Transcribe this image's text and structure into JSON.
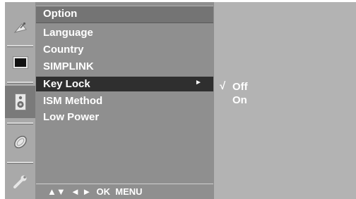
{
  "menu": {
    "title": "Option",
    "items": [
      {
        "label": "Language"
      },
      {
        "label": "Country"
      },
      {
        "label": "SIMPLINK"
      },
      {
        "label": "Key Lock",
        "selected": true
      },
      {
        "label": "ISM Method"
      },
      {
        "label": "Low Power"
      }
    ],
    "submenu_arrow": "►",
    "hint_bar": "▲▼  ◄ ►  OK  MENU"
  },
  "submenu": {
    "check_mark": "√",
    "options": [
      "Off",
      "On"
    ],
    "selected": "Off"
  },
  "sidebar_icons": [
    "satellite-dish-icon",
    "screen-icon",
    "speaker-icon",
    "clock-icon",
    "wrench-icon"
  ],
  "colors": {
    "selected_row": "#2f2f2f",
    "menu_bg": "#8f8f8f",
    "sub_panel_bg": "#b3b3b3",
    "text": "#ffffff"
  }
}
